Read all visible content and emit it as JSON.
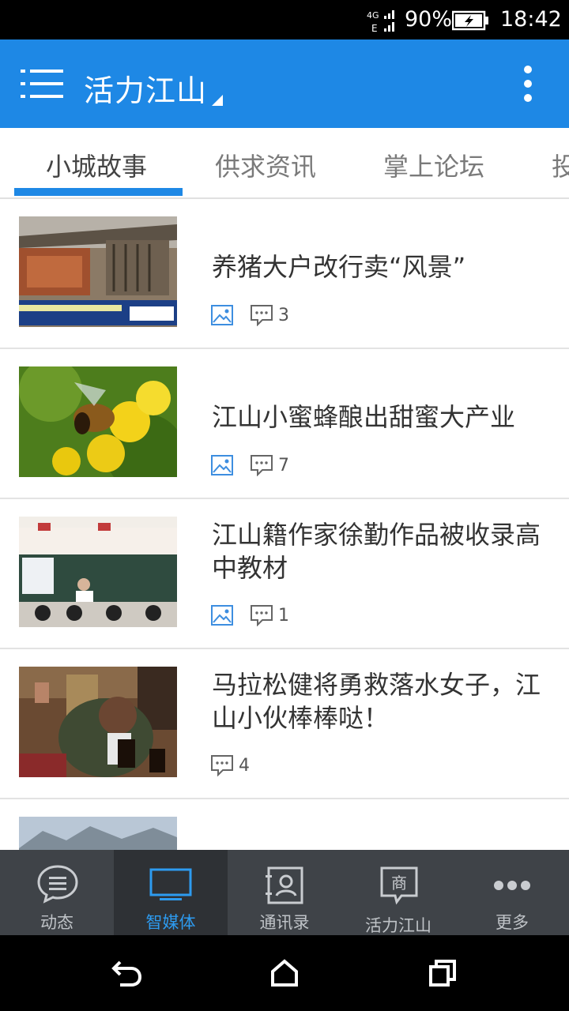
{
  "status_bar": {
    "network": "4G",
    "network2": "E",
    "battery": "90%",
    "time": "18:42"
  },
  "app_bar": {
    "title": "活力江山",
    "menu_icon": "menu-icon",
    "overflow_icon": "more-vert-icon"
  },
  "tabs": [
    {
      "label": "小城故事"
    },
    {
      "label": "供求资讯"
    },
    {
      "label": "掌上论坛"
    },
    {
      "label": "投"
    }
  ],
  "feed": [
    {
      "title": "养猪大户改行卖“风景”",
      "has_image_icon": true,
      "comments": "3"
    },
    {
      "title": "江山小蜜蜂酿出甜蜜大产业",
      "has_image_icon": true,
      "comments": "7"
    },
    {
      "title": "江山籍作家徐勤作品被收录高中教材",
      "has_image_icon": true,
      "comments": "1"
    },
    {
      "title": "马拉松健将勇救落水女子，江山小伙棒棒哒！",
      "has_image_icon": false,
      "comments": "4"
    }
  ],
  "bottom_nav": [
    {
      "label": "动态",
      "icon": "chat-bubble-icon"
    },
    {
      "label": "智媒体",
      "icon": "monitor-icon"
    },
    {
      "label": "通讯录",
      "icon": "contacts-icon"
    },
    {
      "label": "活力江山",
      "icon": "shop-icon"
    },
    {
      "label": "更多",
      "icon": "more-dots-icon"
    }
  ],
  "colors": {
    "primary": "#1e88e5",
    "nav_bg": "#3f4348",
    "nav_active": "#2d9bf0"
  }
}
